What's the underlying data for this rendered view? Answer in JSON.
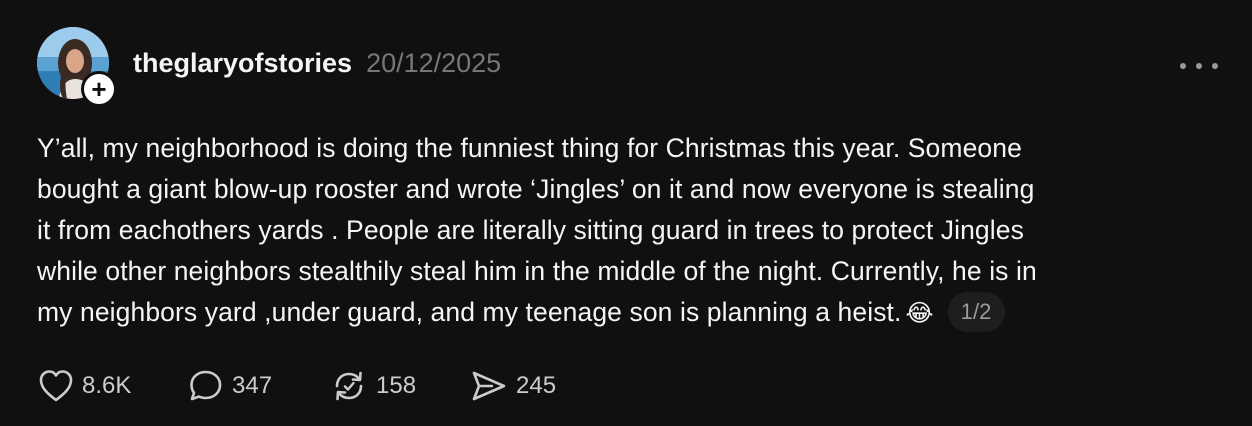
{
  "post": {
    "author": "theglaryofstories",
    "date": "20/12/2025",
    "text_lines": [
      "Y’all, my neighborhood is doing the funniest thing for Christmas this year. Someone",
      "bought a giant blow-up rooster and wrote ‘Jingles’ on it and now everyone is stealing",
      "it from eachothers yards . People are literally sitting guard in trees to protect Jingles",
      "while other neighbors stealthily steal him in the middle of the night. Currently, he is in",
      "my neighbors yard ,under guard, and my teenage son is planning a heist."
    ],
    "emoji": "😂",
    "page_indicator": "1/2",
    "follow_symbol": "+"
  },
  "actions": {
    "likes": "8.6K",
    "replies": "347",
    "reposts": "158",
    "shares": "245"
  },
  "icons": {
    "like": "heart-icon",
    "reply": "comment-bubble-icon",
    "repost": "repost-icon",
    "share": "send-icon",
    "more": "more-horizontal-icon"
  }
}
